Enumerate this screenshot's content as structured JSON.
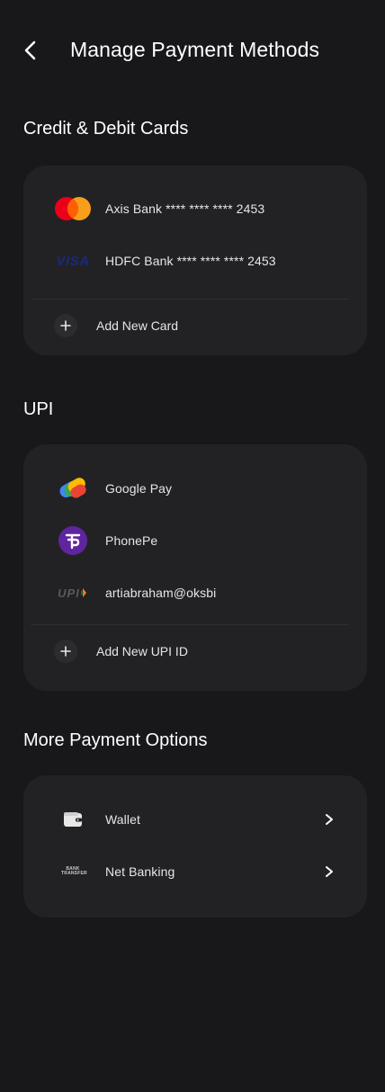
{
  "header": {
    "title": "Manage Payment Methods",
    "back_icon": "chevron-left-icon"
  },
  "cards_section": {
    "title": "Credit & Debit Cards",
    "items": [
      {
        "label": "Axis Bank **** **** **** 2453",
        "icon": "mastercard-icon"
      },
      {
        "label": "HDFC Bank **** **** **** 2453",
        "icon": "visa-icon",
        "icon_text": "VISA"
      }
    ],
    "add_label": "Add New Card"
  },
  "upi_section": {
    "title": "UPI",
    "items": [
      {
        "label": "Google Pay",
        "icon": "google-pay-icon"
      },
      {
        "label": "PhonePe",
        "icon": "phonepe-icon"
      },
      {
        "label": "artiabraham@oksbi",
        "icon": "upi-icon",
        "icon_text": "UPI"
      }
    ],
    "add_label": "Add New UPI ID"
  },
  "more_section": {
    "title": "More Payment Options",
    "items": [
      {
        "label": "Wallet",
        "icon": "wallet-icon"
      },
      {
        "label": "Net Banking",
        "icon": "bank-transfer-icon",
        "icon_text": "BANK TRANSFER"
      }
    ]
  },
  "colors": {
    "background": "#18181a",
    "card": "#222225",
    "mastercard_red": "#eb001b",
    "mastercard_orange": "#f79e1b",
    "visa_blue": "#1a1f71",
    "phonepe_purple": "#5f259f"
  }
}
